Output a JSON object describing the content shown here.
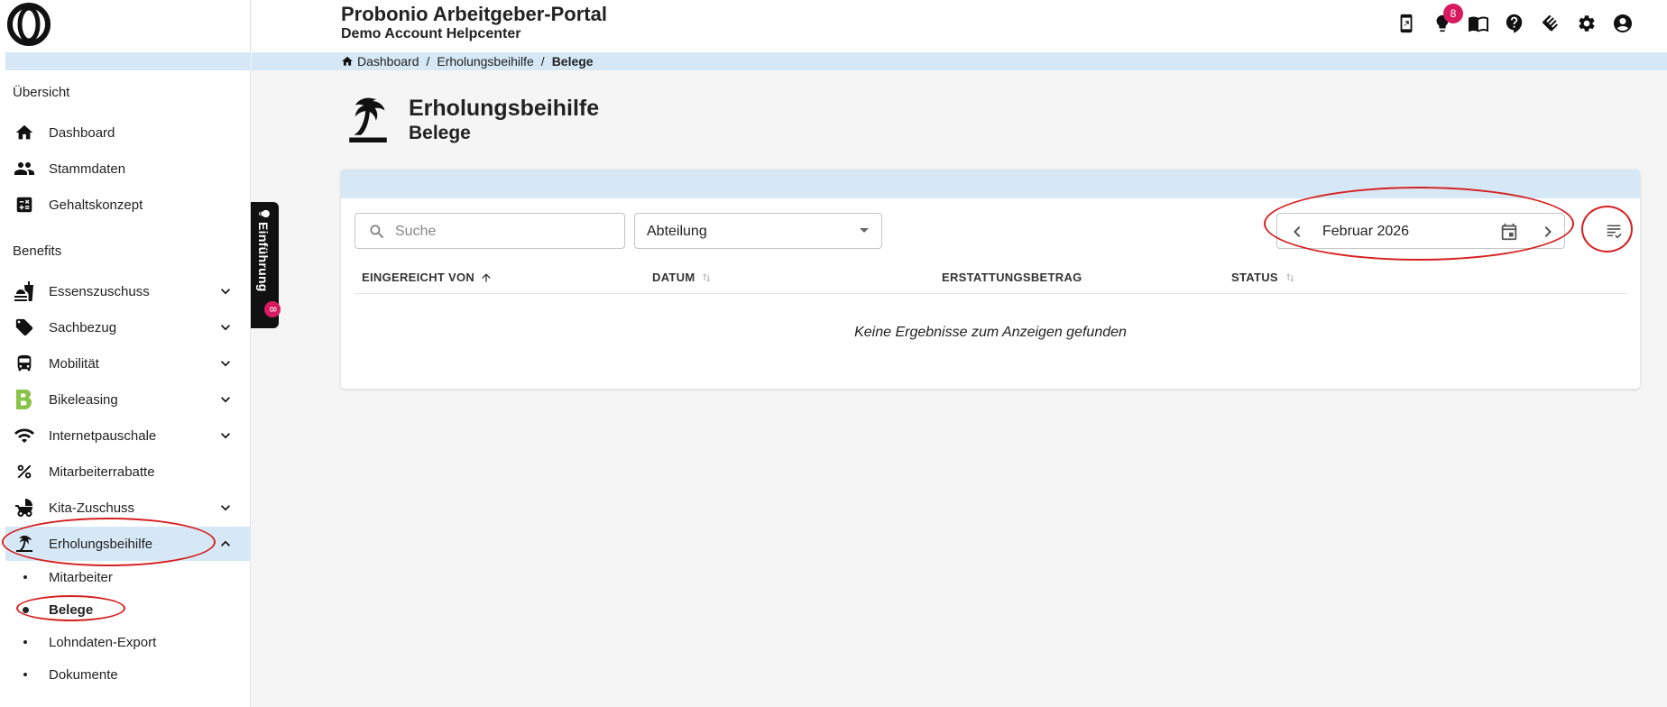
{
  "app": {
    "title": "Probonio Arbeitgeber-Portal",
    "subtitle": "Demo Account Helpcenter",
    "notification_count": "8"
  },
  "header_icons": [
    "app-icon",
    "lightbulb-icon",
    "book-icon",
    "help-icon",
    "handshake-icon",
    "gear-icon",
    "account-icon"
  ],
  "breadcrumb": {
    "items": [
      "Dashboard",
      "Erholungsbeihilfe"
    ],
    "current": "Belege",
    "separator": "/"
  },
  "sidebar": {
    "overview_heading": "Übersicht",
    "overview_items": [
      {
        "label": "Dashboard",
        "icon": "home-icon"
      },
      {
        "label": "Stammdaten",
        "icon": "people-icon"
      },
      {
        "label": "Gehaltskonzept",
        "icon": "calculator-icon"
      }
    ],
    "benefits_heading": "Benefits",
    "benefit_items": [
      {
        "label": "Essenszuschuss",
        "icon": "food-icon",
        "expandable": true
      },
      {
        "label": "Sachbezug",
        "icon": "tag-icon",
        "expandable": true
      },
      {
        "label": "Mobilität",
        "icon": "bus-icon",
        "expandable": true
      },
      {
        "label": "Bikeleasing",
        "icon": "bikeleasing-icon",
        "expandable": true
      },
      {
        "label": "Internetpauschale",
        "icon": "wifi-icon",
        "expandable": true
      },
      {
        "label": "Mitarbeiterrabatte",
        "icon": "percent-icon",
        "expandable": false
      },
      {
        "label": "Kita-Zuschuss",
        "icon": "stroller-icon",
        "expandable": true
      },
      {
        "label": "Erholungsbeihilfe",
        "icon": "palm-tree-icon",
        "expandable": true,
        "active": true
      }
    ],
    "sub_items": [
      {
        "label": "Mitarbeiter"
      },
      {
        "label": "Belege",
        "active": true
      },
      {
        "label": "Lohndaten-Export"
      },
      {
        "label": "Dokumente"
      }
    ]
  },
  "intro_tab": {
    "label": "Einführung",
    "badge": "8"
  },
  "page": {
    "title": "Erholungsbeihilfe",
    "subtitle": "Belege"
  },
  "filters": {
    "search_placeholder": "Suche",
    "department_value": "Abteilung",
    "month_value": "Februar 2026"
  },
  "table": {
    "columns": [
      {
        "label": "EINGEREICHT VON",
        "sort": "asc"
      },
      {
        "label": "DATUM",
        "sort": "none"
      },
      {
        "label": "ERSTATTUNGSBETRAG",
        "sort": "unsortable"
      },
      {
        "label": "STATUS",
        "sort": "none"
      }
    ],
    "empty_message": "Keine Ergebnisse zum Anzeigen gefunden"
  },
  "colors": {
    "accent_light": "#d6e8f6",
    "badge": "#d81b60",
    "annotation": "#d62020",
    "bikeleasing": "#8bc34a"
  }
}
